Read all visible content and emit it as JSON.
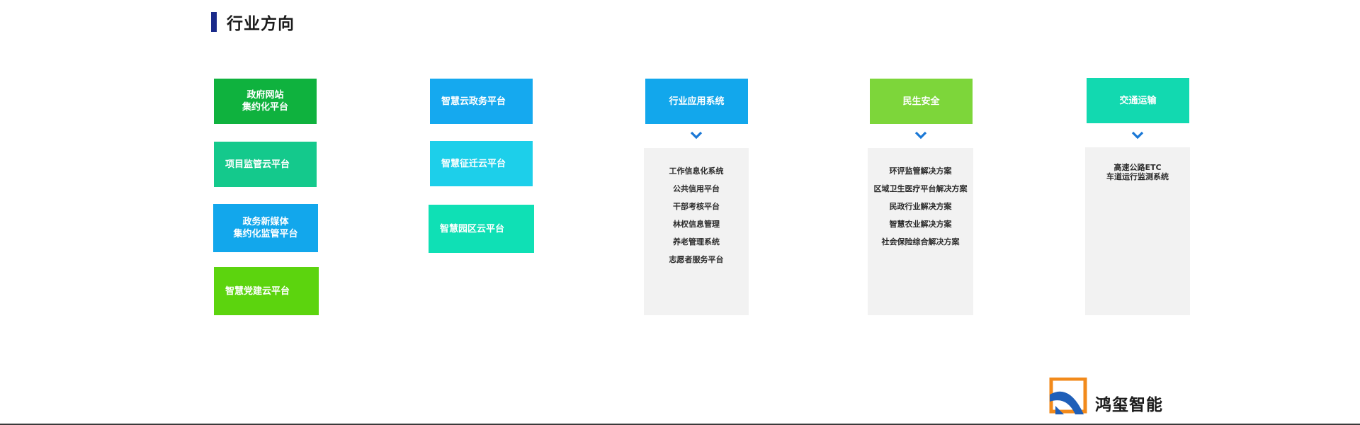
{
  "header": {
    "title": "行业方向"
  },
  "col1": [
    {
      "label": "政府网站\n集约化平台",
      "color": "#0fb23e"
    },
    {
      "label": "项目监管云平台",
      "color": "#14c98c"
    },
    {
      "label": "政务新媒体\n集约化监管平台",
      "color": "#12a7ec"
    },
    {
      "label": "智慧党建云平台",
      "color": "#5cd40e"
    }
  ],
  "col2": [
    {
      "label": "智慧云政务平台",
      "color": "#15a9ef"
    },
    {
      "label": "智慧征迁云平台",
      "color": "#1dcfea"
    },
    {
      "label": "智慧园区云平台",
      "color": "#0fe0b5"
    }
  ],
  "categories": [
    {
      "label": "行业应用系统",
      "color": "#12a7ec",
      "items": [
        "工作信息化系统",
        "公共信用平台",
        "干部考核平台",
        "林权信息管理",
        "养老管理系统",
        "志愿者服务平台"
      ]
    },
    {
      "label": "民生安全",
      "color": "#7dd63a",
      "items": [
        "环评监管解决方案",
        "区域卫生医疗平台解决方案",
        "民政行业解决方案",
        "智慧农业解决方案",
        "社会保险综合解决方案"
      ]
    },
    {
      "label": "交通运输",
      "color": "#12d9b0",
      "items": [
        "高速公路ETC",
        "车道运行监测系统"
      ]
    }
  ],
  "accent_chevron": "#1a78d6",
  "brand": {
    "name": "鸿玺智能",
    "logo_icon": "brand-logo-icon"
  }
}
